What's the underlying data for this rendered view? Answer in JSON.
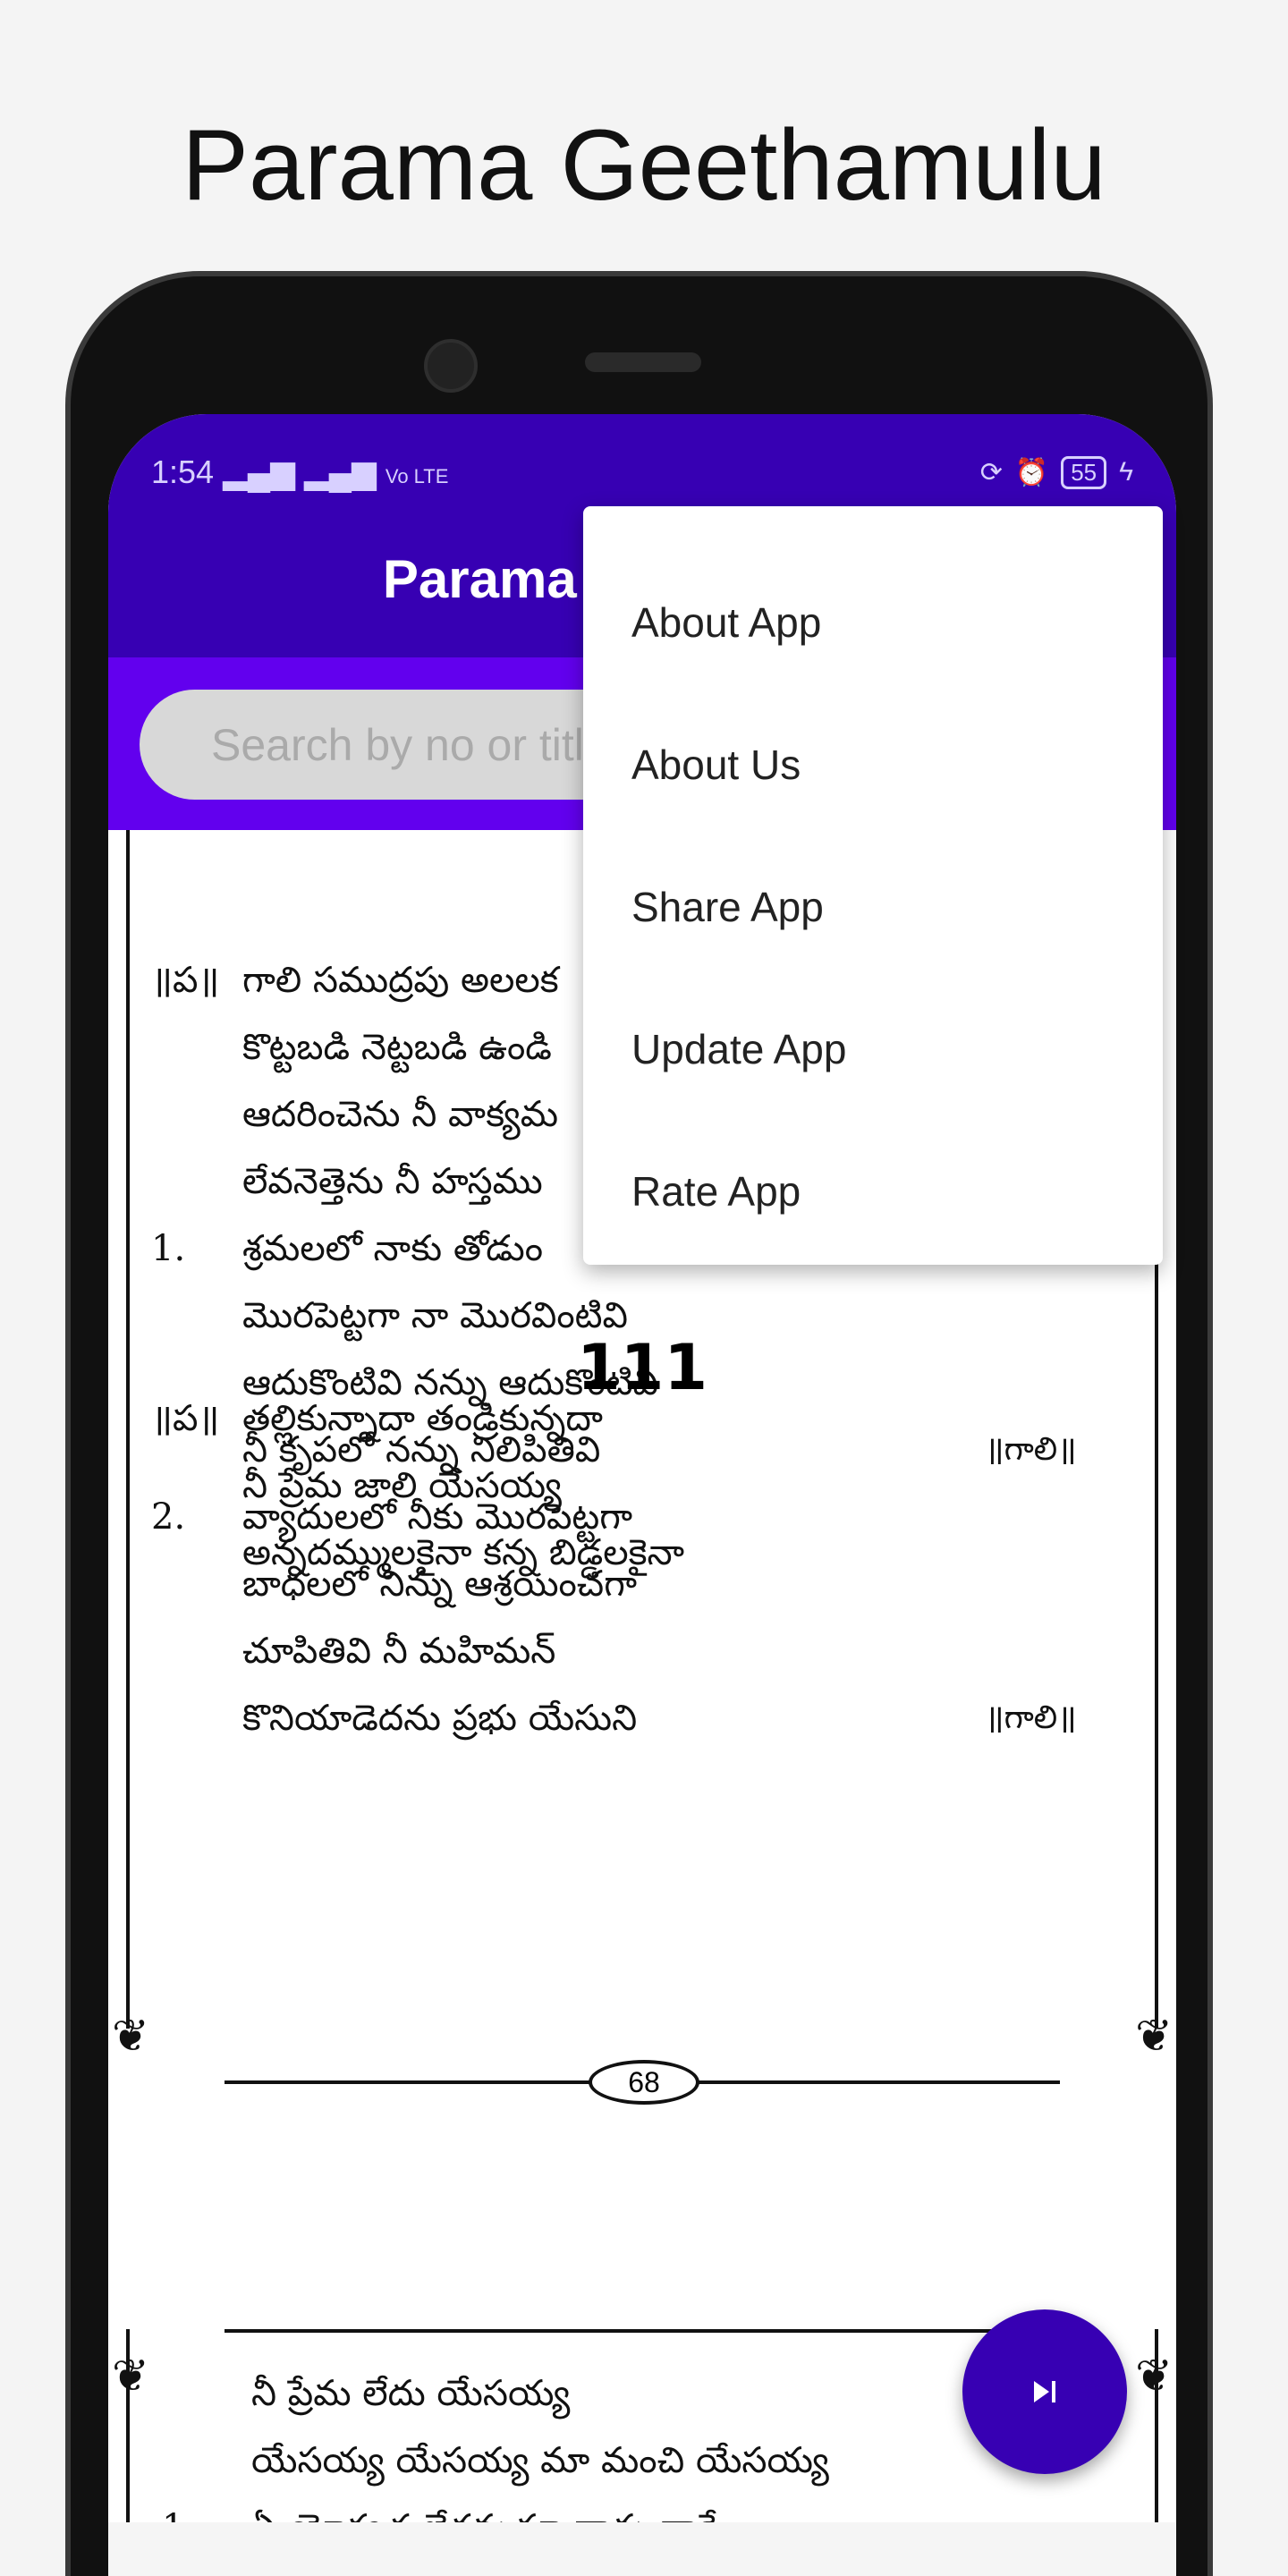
{
  "promo_title": "Parama Geethamulu",
  "status": {
    "time": "1:54",
    "network": "Vo LTE",
    "battery": "55"
  },
  "app_title": "Parama Geethamulu",
  "search": {
    "placeholder": "Search by no or title",
    "value": ""
  },
  "menu": {
    "items": [
      {
        "label": "About App"
      },
      {
        "label": "About Us"
      },
      {
        "label": "Share App"
      },
      {
        "label": "Update App"
      },
      {
        "label": "Rate App"
      }
    ]
  },
  "song1": {
    "lines": [
      {
        "label": "॥ప॥",
        "text": "గాలి సముద్రపు అలలక",
        "ref": ""
      },
      {
        "label": "",
        "text": "కొట్టబడి నెట్టబడి ఉండి",
        "ref": ""
      },
      {
        "label": "",
        "text": "ఆదరించెను నీ వాక్యమ",
        "ref": ""
      },
      {
        "label": "",
        "text": "లేవనెత్తెను నీ హస్తము",
        "ref": ""
      },
      {
        "label": "1.",
        "text": "శ్రమలలో నాకు తోడుం",
        "ref": ""
      },
      {
        "label": "",
        "text": "మొరపెట్టగా నా మొరవింటివి",
        "ref": ""
      },
      {
        "label": "",
        "text": "ఆదుకొంటివి నన్ను ఆదుకొంటివి",
        "ref": ""
      },
      {
        "label": "",
        "text": "నీ కృపలో నన్ను నిలిపితివి",
        "ref": "॥గాలి॥"
      },
      {
        "label": "2.",
        "text": "వ్యాదులలో నీకు మొరపెట్టగా",
        "ref": ""
      },
      {
        "label": "",
        "text": "బాధలలో నిన్ను ఆశ్రయించగా",
        "ref": ""
      },
      {
        "label": "",
        "text": "చూపితివి నీ మహిమన్",
        "ref": ""
      },
      {
        "label": "",
        "text": "కొనియాడెదను ప్రభు యేసుని",
        "ref": "॥గాలి॥"
      }
    ]
  },
  "song2": {
    "number": "111",
    "lines": [
      {
        "label": "॥ప॥",
        "text": "తల్లికున్నాదా తండ్రికున్నదా"
      },
      {
        "label": "",
        "text": "నీ ప్రేమ జాలి యేసయ్య"
      },
      {
        "label": "",
        "text": "అన్నదమ్ములకైనా కన్న బిడ్డలకైనా"
      }
    ]
  },
  "page_number": "68",
  "page2": {
    "lines": [
      {
        "label": "",
        "text": "నీ  ప్రేమ లేదు యేసయ్య"
      },
      {
        "label": "",
        "text": "యేసయ్య యేసయ్య మా మంచి యేసయ్య"
      },
      {
        "label": "1.",
        "text": "ఏ యోగ్యత లేదనుచూ నాదు వారే"
      }
    ]
  },
  "fab_icon": "skip-next-icon",
  "colors": {
    "primary_dark": "#3700b3",
    "primary": "#6200ee"
  }
}
